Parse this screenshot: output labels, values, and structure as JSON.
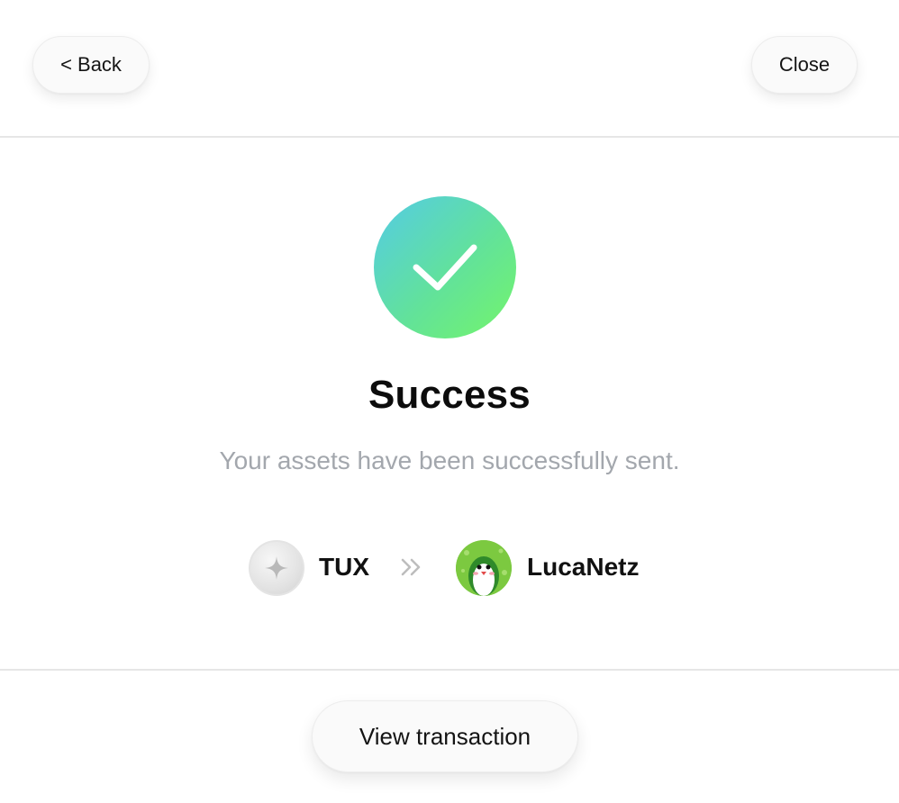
{
  "header": {
    "back_label": "< Back",
    "close_label": "Close"
  },
  "status": {
    "icon": "checkmark-icon",
    "title": "Success",
    "message": "Your assets have been successfully sent."
  },
  "transfer": {
    "asset": {
      "icon": "sparkle-icon",
      "symbol": "TUX"
    },
    "direction_icon": "double-chevron-right-icon",
    "recipient": {
      "icon": "penguin-avatar",
      "name": "LucaNetz"
    }
  },
  "footer": {
    "view_transaction_label": "View transaction"
  },
  "colors": {
    "success_gradient_start": "#54cbe6",
    "success_gradient_end": "#74f56a",
    "subtitle_text": "#a3a7ad",
    "divider": "#e6e6e6"
  }
}
